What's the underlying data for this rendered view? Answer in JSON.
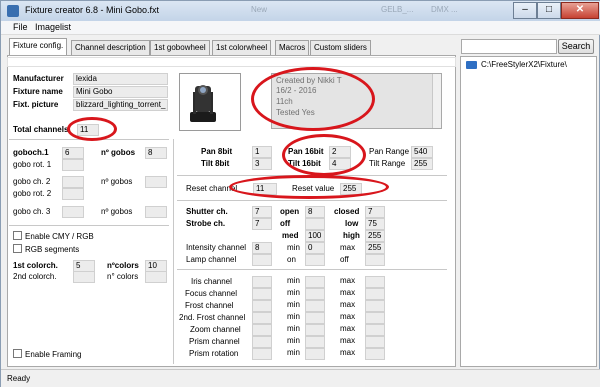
{
  "window": {
    "title": "Fixture creator 6.8 - Mini Gobo.fxt",
    "bg_tabs": [
      "New",
      "GELB_...",
      "DMX ..."
    ],
    "minimize": "–",
    "maximize": "□",
    "close": "✕"
  },
  "menu": {
    "file": "File",
    "imagelist": "Imagelist"
  },
  "tabs": [
    {
      "label": "Fixture config."
    },
    {
      "label": "Channel description"
    },
    {
      "label": "1st gobowheel"
    },
    {
      "label": "1st colorwheel"
    },
    {
      "label": "Macros"
    },
    {
      "label": "Custom sliders"
    }
  ],
  "search": {
    "button": "Search"
  },
  "tree": {
    "path": "C:\\FreeStylerX2\\Fixture\\"
  },
  "fixture": {
    "manufacturer_label": "Manufacturer",
    "manufacturer": "lexida",
    "name_label": "Fixture name",
    "name": "Mini Gobo",
    "picture_label": "Fixt. picture",
    "picture": "blizzard_lighting_torrent_",
    "notes": [
      "Created by Nikki T",
      "16/2 - 2016",
      "11ch",
      "Tested Yes"
    ],
    "total_label": "Total channels",
    "total": "11"
  },
  "gobos": {
    "goboch1_label": "goboch.1",
    "goboch1": "6",
    "ngobos_label": "nº gobos",
    "ngobos1": "8",
    "gobo_rot1_label": "gobo rot. 1",
    "goboch2_label": "gobo ch. 2",
    "ngobos2_label": "nº gobos",
    "gobo_rot2_label": "gobo rot. 2",
    "goboch3_label": "gobo ch. 3",
    "ngobos3_label": "nº gobos"
  },
  "options": {
    "enable_cmy": "Enable CMY / RGB",
    "rgb_segments": "RGB segments",
    "colorch1_label": "1st colorch.",
    "colorch1": "5",
    "ncolors_label": "nºcolors",
    "ncolors": "10",
    "colorch2_label": "2nd colorch.",
    "ncolors2_label": "n° colors",
    "enable_framing": "Enable Framing"
  },
  "pantilt": {
    "pan8_label": "Pan 8bit",
    "pan8": "1",
    "tilt8_label": "Tilt 8bit",
    "tilt8": "3",
    "pan16_label": "Pan 16bit",
    "pan16": "2",
    "tilt16_label": "Tilt 16bit",
    "tilt16": "4",
    "pan_range_label": "Pan Range",
    "pan_range": "540",
    "tilt_range_label": "Tilt Range",
    "tilt_range": "255"
  },
  "reset": {
    "channel_label": "Reset channel",
    "channel": "11",
    "value_label": "Reset value",
    "value": "255"
  },
  "shutter": {
    "shutter_label": "Shutter ch.",
    "shutter": "7",
    "strobe_label": "Strobe ch.",
    "strobe": "7",
    "open_label": "open",
    "open": "8",
    "off_label": "off",
    "closed_label": "closed",
    "closed": "7",
    "med_label": "med",
    "med": "100",
    "low_label": "low",
    "low": "75",
    "high_label": "high",
    "high": "255"
  },
  "intensity": {
    "label": "Intensity channel",
    "value": "8",
    "min_label": "min",
    "min": "0",
    "max_label": "max",
    "max": "255",
    "lamp_label": "Lamp channel",
    "on_label": "on",
    "off_label": "off"
  },
  "extra_channels": [
    {
      "name": "Iris channel"
    },
    {
      "name": "Focus channel"
    },
    {
      "name": "Frost channel"
    },
    {
      "name": "2nd. Frost channel"
    },
    {
      "name": "Zoom channel"
    },
    {
      "name": "Prism channel"
    },
    {
      "name": "Prism rotation"
    }
  ],
  "minmax": {
    "min": "min",
    "max": "max"
  },
  "status": {
    "text": "Ready"
  },
  "colors": {
    "ring": "#d8161c",
    "folder": "#2f6fc3"
  }
}
